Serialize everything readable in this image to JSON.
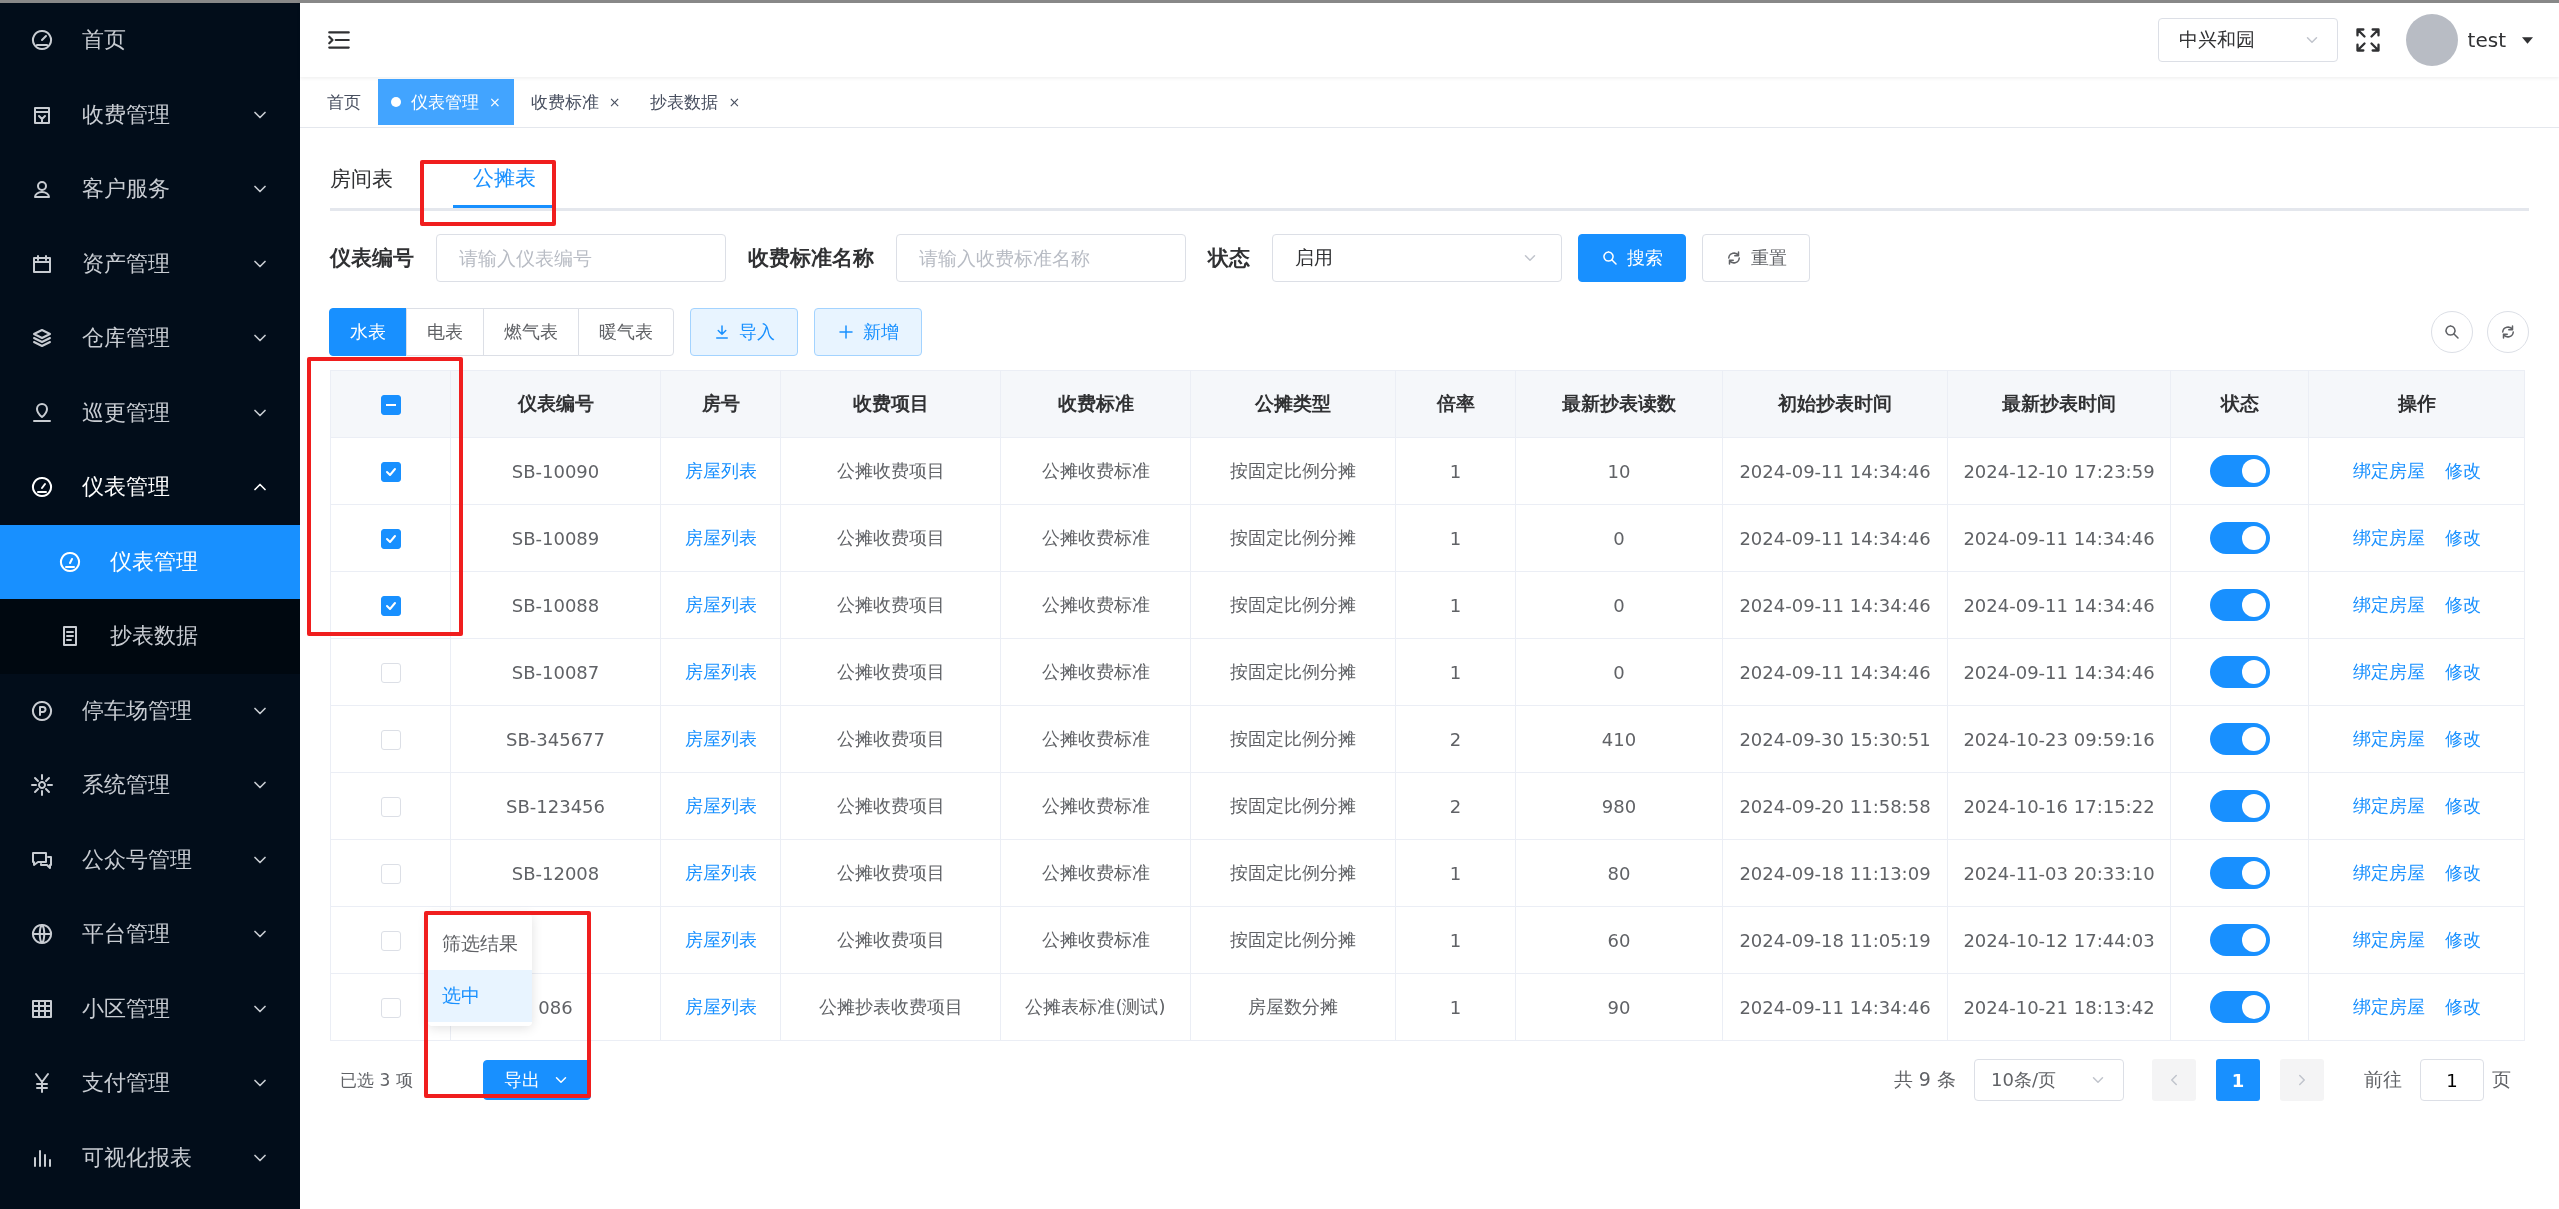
{
  "sidebar": {
    "items": [
      {
        "label": "首页"
      },
      {
        "label": "收费管理",
        "expanded": false
      },
      {
        "label": "客户服务",
        "expanded": false
      },
      {
        "label": "资产管理",
        "expanded": false
      },
      {
        "label": "仓库管理",
        "expanded": false
      },
      {
        "label": "巡更管理",
        "expanded": false
      },
      {
        "label": "仪表管理",
        "expanded": true,
        "children": [
          {
            "label": "仪表管理",
            "selected": true
          },
          {
            "label": "抄表数据",
            "selected": false
          }
        ]
      },
      {
        "label": "停车场管理",
        "expanded": false
      },
      {
        "label": "系统管理",
        "expanded": false
      },
      {
        "label": "公众号管理",
        "expanded": false
      },
      {
        "label": "平台管理",
        "expanded": false
      },
      {
        "label": "小区管理",
        "expanded": false
      },
      {
        "label": "支付管理",
        "expanded": false
      },
      {
        "label": "可视化报表",
        "expanded": false
      }
    ]
  },
  "header": {
    "community": "中兴和园",
    "user": "test"
  },
  "page_tabs": [
    {
      "label": "首页",
      "selected": false
    },
    {
      "label": "仪表管理",
      "selected": true,
      "close": "×"
    },
    {
      "label": "收费标准",
      "selected": false,
      "close": "×"
    },
    {
      "label": "抄表数据",
      "selected": false,
      "close": "×"
    }
  ],
  "sub_tabs": [
    {
      "label": "房间表",
      "selected": false
    },
    {
      "label": "公摊表",
      "selected": true
    }
  ],
  "filters": {
    "meter_no": {
      "label": "仪表编号",
      "placeholder": "请输入仪表编号"
    },
    "standard": {
      "label": "收费标准名称",
      "placeholder": "请输入收费标准名称"
    },
    "status": {
      "label": "状态",
      "value": "启用"
    },
    "search": "搜索",
    "reset": "重置"
  },
  "meter_types": [
    {
      "label": "水表",
      "selected": true
    },
    {
      "label": "电表",
      "selected": false
    },
    {
      "label": "燃气表",
      "selected": false
    },
    {
      "label": "暖气表",
      "selected": false
    }
  ],
  "actions": {
    "import": "导入",
    "add": "新增"
  },
  "table": {
    "header_indeterminate": true,
    "columns": [
      "仪表编号",
      "房号",
      "收费项目",
      "收费标准",
      "公摊类型",
      "倍率",
      "最新抄表读数",
      "初始抄表时间",
      "最新抄表时间",
      "状态",
      "操作"
    ],
    "rows": [
      {
        "checked": true,
        "meter_no": "SB-10090",
        "room": "房屋列表",
        "item": "公摊收费项目",
        "standard": "公摊收费标准",
        "share_type": "按固定比例分摊",
        "rate": "1",
        "reading": "10",
        "initial_time": "2024-09-11 14:34:46",
        "latest_time": "2024-12-10 17:23:59",
        "enabled": true,
        "actions": [
          "绑定房屋",
          "修改"
        ]
      },
      {
        "checked": true,
        "meter_no": "SB-10089",
        "room": "房屋列表",
        "item": "公摊收费项目",
        "standard": "公摊收费标准",
        "share_type": "按固定比例分摊",
        "rate": "1",
        "reading": "0",
        "initial_time": "2024-09-11 14:34:46",
        "latest_time": "2024-09-11 14:34:46",
        "enabled": true,
        "actions": [
          "绑定房屋",
          "修改"
        ]
      },
      {
        "checked": true,
        "meter_no": "SB-10088",
        "room": "房屋列表",
        "item": "公摊收费项目",
        "standard": "公摊收费标准",
        "share_type": "按固定比例分摊",
        "rate": "1",
        "reading": "0",
        "initial_time": "2024-09-11 14:34:46",
        "latest_time": "2024-09-11 14:34:46",
        "enabled": true,
        "actions": [
          "绑定房屋",
          "修改"
        ]
      },
      {
        "checked": false,
        "meter_no": "SB-10087",
        "room": "房屋列表",
        "item": "公摊收费项目",
        "standard": "公摊收费标准",
        "share_type": "按固定比例分摊",
        "rate": "1",
        "reading": "0",
        "initial_time": "2024-09-11 14:34:46",
        "latest_time": "2024-09-11 14:34:46",
        "enabled": true,
        "actions": [
          "绑定房屋",
          "修改"
        ]
      },
      {
        "checked": false,
        "meter_no": "SB-345677",
        "room": "房屋列表",
        "item": "公摊收费项目",
        "standard": "公摊收费标准",
        "share_type": "按固定比例分摊",
        "rate": "2",
        "reading": "410",
        "initial_time": "2024-09-30 15:30:51",
        "latest_time": "2024-10-23 09:59:16",
        "enabled": true,
        "actions": [
          "绑定房屋",
          "修改"
        ]
      },
      {
        "checked": false,
        "meter_no": "SB-123456",
        "room": "房屋列表",
        "item": "公摊收费项目",
        "standard": "公摊收费标准",
        "share_type": "按固定比例分摊",
        "rate": "2",
        "reading": "980",
        "initial_time": "2024-09-20 11:58:58",
        "latest_time": "2024-10-16 17:15:22",
        "enabled": true,
        "actions": [
          "绑定房屋",
          "修改"
        ]
      },
      {
        "checked": false,
        "meter_no": "SB-12008",
        "room": "房屋列表",
        "item": "公摊收费项目",
        "standard": "公摊收费标准",
        "share_type": "按固定比例分摊",
        "rate": "1",
        "reading": "80",
        "initial_time": "2024-09-18 11:13:09",
        "latest_time": "2024-11-03 20:33:10",
        "enabled": true,
        "actions": [
          "绑定房屋",
          "修改"
        ]
      },
      {
        "checked": false,
        "room": "房屋列表",
        "item": "公摊收费项目",
        "standard": "公摊收费标准",
        "share_type": "按固定比例分摊",
        "rate": "1",
        "reading": "60",
        "initial_time": "2024-09-18 11:05:19",
        "latest_time": "2024-10-12 17:44:03",
        "enabled": true,
        "actions": [
          "绑定房屋",
          "修改"
        ]
      },
      {
        "checked": false,
        "meter_no": "086",
        "room": "房屋列表",
        "item": "公摊抄表收费项目",
        "standard": "公摊表标准(测试)",
        "share_type": "房屋数分摊",
        "rate": "1",
        "reading": "90",
        "initial_time": "2024-09-11 14:34:46",
        "latest_time": "2024-10-21 18:13:42",
        "enabled": true,
        "actions": [
          "绑定房屋",
          "修改"
        ]
      }
    ]
  },
  "footer": {
    "selected_count": "已选 3 项",
    "export": "导出",
    "export_menu": [
      {
        "label": "筛选结果",
        "selected": false
      },
      {
        "label": "选中",
        "selected": true
      }
    ],
    "total": "共 9 条",
    "page_size": "10条/页",
    "pages": [
      {
        "label": "1",
        "selected": true
      }
    ],
    "goto": "前往",
    "goto_value": "1",
    "page_unit": "页"
  }
}
